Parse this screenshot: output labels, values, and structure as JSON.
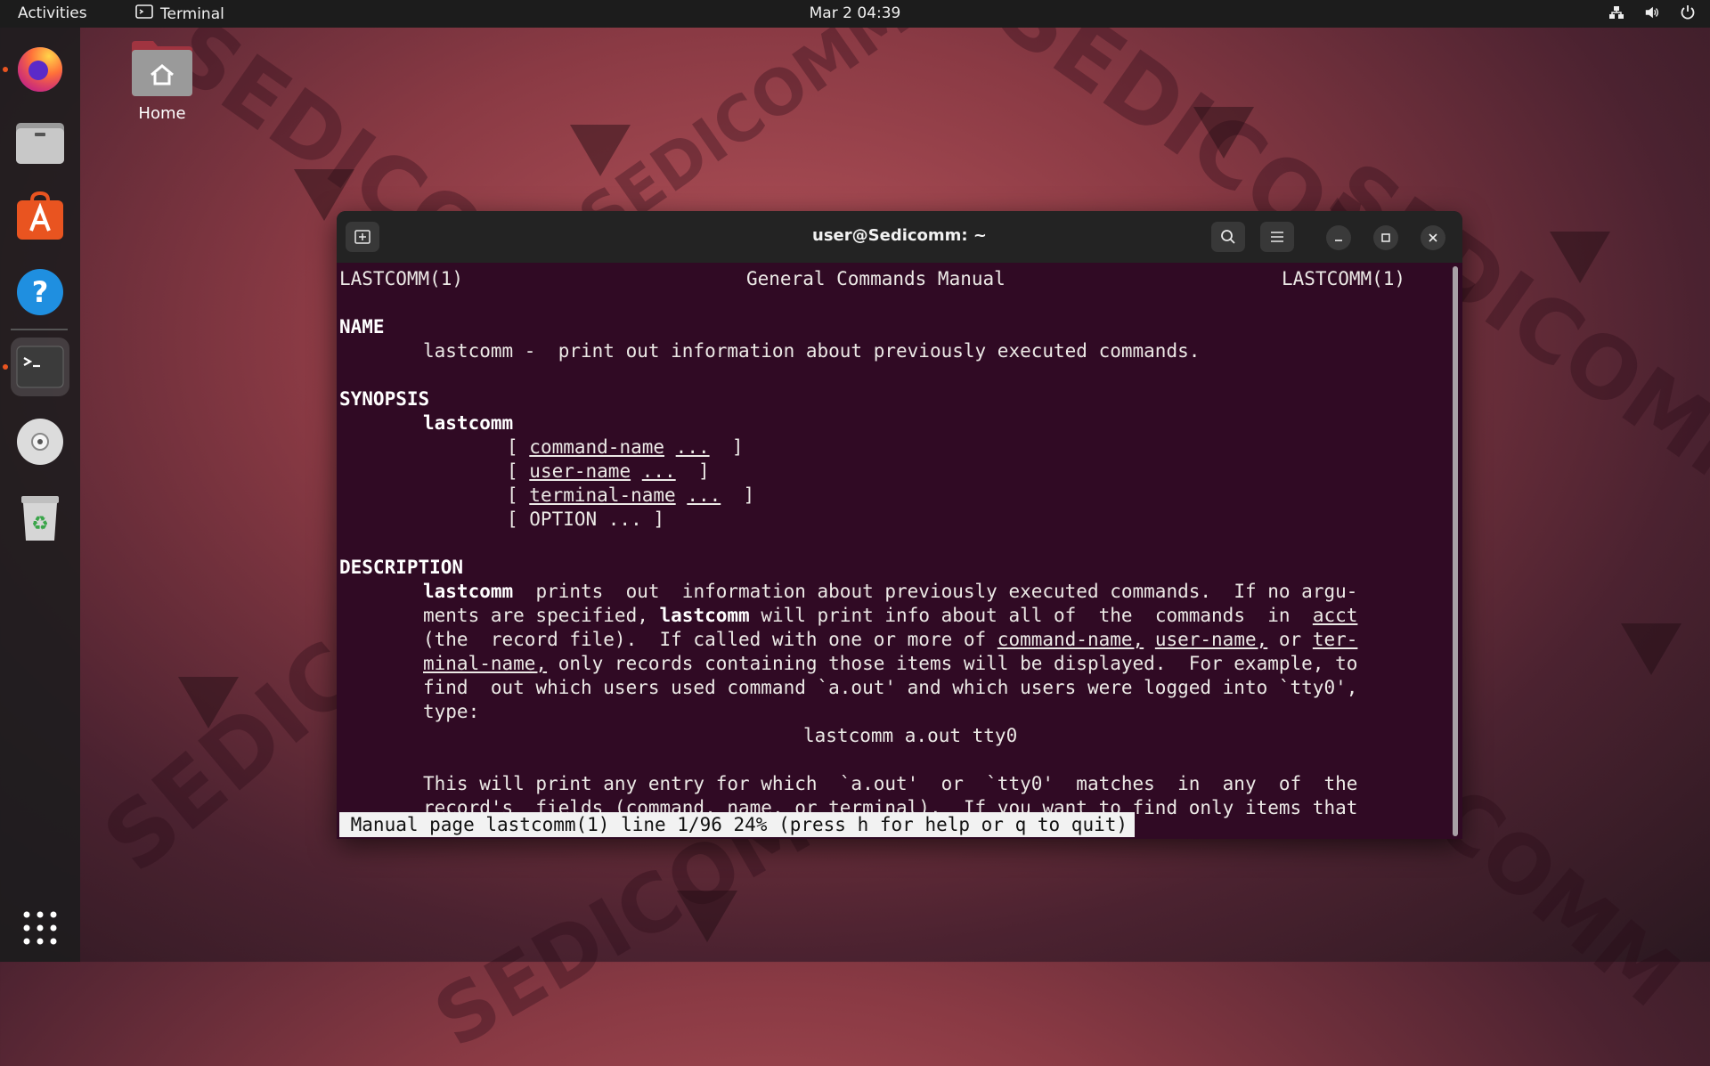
{
  "topbar": {
    "activities": "Activities",
    "app_name": "Terminal",
    "clock": "Mar 2  04:39"
  },
  "desktop": {
    "home_label": "Home"
  },
  "dock": {
    "items": [
      "firefox-icon",
      "files-icon",
      "software-icon",
      "help-icon",
      "terminal-icon",
      "disc-icon",
      "trash-icon",
      "show-apps-icon"
    ]
  },
  "terminal": {
    "title": "user@Sedicomm: ~",
    "header_left": "LASTCOMM(1)",
    "header_center": "General Commands Manual",
    "header_right": "LASTCOMM(1)",
    "name_heading": "NAME",
    "name_line": "lastcomm -  print out information about previously executed commands.",
    "synopsis_heading": "SYNOPSIS",
    "synopsis_cmd": "lastcomm",
    "synopsis_opts": [
      {
        "open": "[ ",
        "arg": "command-name",
        "dots": "...",
        "close": "  ]"
      },
      {
        "open": "[ ",
        "arg": "user-name",
        "dots": "...",
        "close": "  ]"
      },
      {
        "open": "[ ",
        "arg": "terminal-name",
        "dots": "...",
        "close": "  ]"
      }
    ],
    "synopsis_option": "[ OPTION ... ]",
    "description_heading": "DESCRIPTION",
    "desc1_cmd": "lastcomm",
    "desc1_rest": "  prints  out  information about previously executed commands.  If no argu-",
    "desc2_a": "ments are specified, ",
    "desc2_cmd": "lastcomm",
    "desc2_b": " will print info about all of  the  commands  in  ",
    "desc2_acct": "acct",
    "desc3_a": "(the  record file).  If called with one or more of ",
    "desc3_u1": "command-name,",
    "desc3_sp": " ",
    "desc3_u2": "user-name,",
    "desc3_or": " or ",
    "desc3_u3": "ter-",
    "desc4_u": "minal-name,",
    "desc4_rest": " only records containing those items will be displayed.  For example, to",
    "desc5": "find  out which users used command `a.out' and which users were logged into `tty0',",
    "desc6": "type:",
    "example": "lastcomm a.out tty0",
    "desc7": "This will print any entry for which  `a.out'  or  `tty0'  matches  in  any  of  the",
    "desc8": "record's  fields (command, name, or terminal).  If you want to find only items that",
    "status": " Manual page lastcomm(1) line 1/96 24% (press h for help or q to quit)"
  }
}
